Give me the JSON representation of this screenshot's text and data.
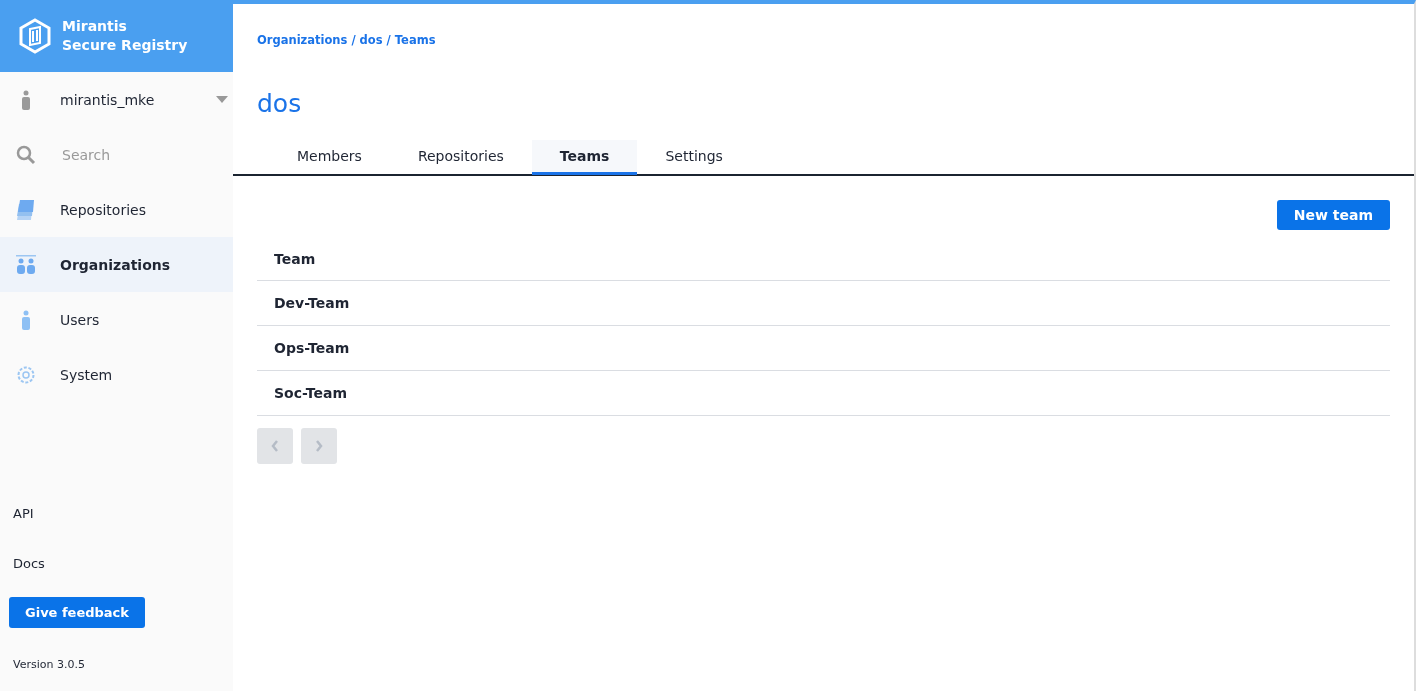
{
  "brand": {
    "line_1": "Mirantis",
    "line_2": "Secure Registry"
  },
  "user": {
    "name": "mirantis_mke"
  },
  "search": {
    "placeholder": "Search"
  },
  "nav": [
    {
      "kind": "repos",
      "label": "Repositories",
      "selected": false
    },
    {
      "kind": "orgs",
      "label": "Organizations",
      "selected": true
    },
    {
      "kind": "user",
      "label": "Users",
      "selected": false
    },
    {
      "kind": "gear",
      "label": "System",
      "selected": false
    }
  ],
  "links": [
    "API",
    "Docs"
  ],
  "feedback_button": "Give feedback",
  "version": "Version 3.0.5",
  "breadcrumb": "Organizations / dos / Teams",
  "title": "dos",
  "tabs": [
    {
      "label": "Members",
      "selected": false
    },
    {
      "label": "Repositories",
      "selected": false
    },
    {
      "label": "Teams",
      "selected": true
    },
    {
      "label": "Settings",
      "selected": false
    }
  ],
  "new_button": "New team",
  "table": {
    "column": "Team",
    "rows": [
      "Dev-Team",
      "Ops-Team",
      "Soc-Team"
    ]
  },
  "pager": {
    "prev_disabled": true,
    "next_disabled": true
  }
}
